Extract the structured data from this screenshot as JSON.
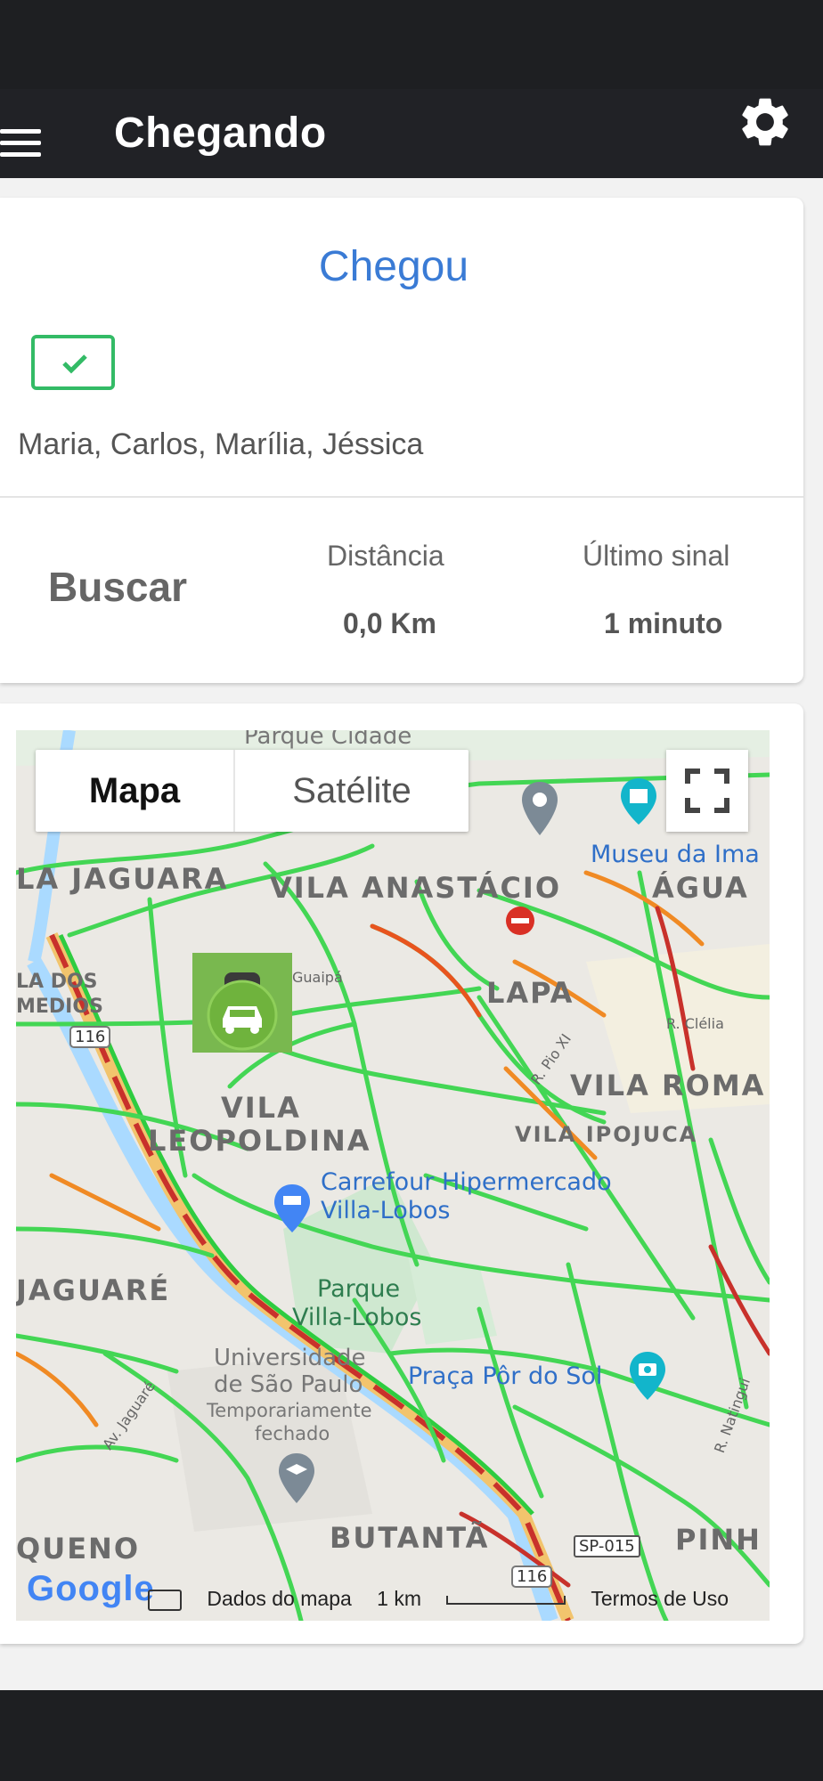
{
  "appbar": {
    "title": "Chegando",
    "menu_icon": "hamburger-icon",
    "settings_icon": "gear-icon"
  },
  "status_card": {
    "title": "Chegou",
    "title_color": "#3a7bd5",
    "check_icon": "check-icon",
    "check_color": "#33bb66",
    "passengers": "Maria, Carlos, Marília, Jéssica"
  },
  "info_card": {
    "search_label": "Buscar",
    "distance": {
      "label": "Distância",
      "value": "0,0 Km"
    },
    "last_signal": {
      "label": "Último sinal",
      "value": "1 minuto"
    }
  },
  "map": {
    "type_control": {
      "map": "Mapa",
      "satellite": "Satélite"
    },
    "fullscreen_icon": "fullscreen-icon",
    "labels": {
      "parque_cidade": "Parque Cidade",
      "vila_jaguara": "LA JAGUARA",
      "vila_anastacio": "VILA ANASTÁCIO",
      "agua": "ÁGUA",
      "museu": "Museu da Ima",
      "lapa": "LAPA",
      "vila_dos_remedios_1": "LA DOS",
      "vila_dos_remedios_2": "MEDIOS",
      "vila_romana": "VILA ROMA",
      "vila_leopoldina_1": "VILA",
      "vila_leopoldina_2": "LEOPOLDINA",
      "vila_ipojuca": "VILA IPOJUCA",
      "carrefour_1": "Carrefour Hipermercado",
      "carrefour_2": "Villa-Lobos",
      "jaguare": "JAGUARÉ",
      "parque_villa_lobos_1": "Parque",
      "parque_villa_lobos_2": "Villa-Lobos",
      "usp_1": "Universidade",
      "usp_2": "de São Paulo",
      "usp_3": "Temporariamente",
      "usp_4": "fechado",
      "praca": "Praça Pôr do Sol",
      "butanta": "BUTANTÃ",
      "pinheiros": "PINH",
      "rio_pequeno": "QUENO",
      "guaipa": "Guaipá",
      "r_clelia": "R. Clélia",
      "r_pio_xi": "R. Pio XI",
      "av_jaguare": "Av. Jaguaré",
      "r_natingui": "R. Natingui",
      "shield_116_a": "116",
      "shield_116_b": "116",
      "shield_sp015": "SP-015"
    },
    "car_marker_icon": "car-icon",
    "google_logo": "Google",
    "footer": {
      "data": "Dados do mapa",
      "scale": "1 km",
      "terms": "Termos de Uso"
    }
  }
}
